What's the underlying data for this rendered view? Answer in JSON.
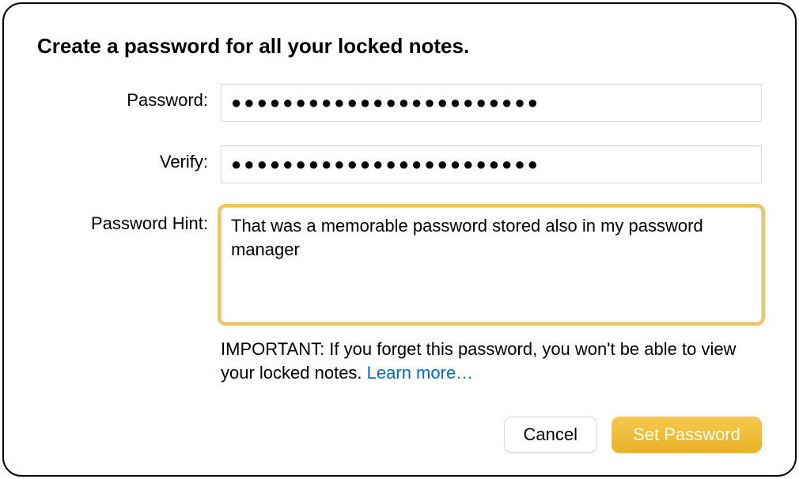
{
  "dialog": {
    "title": "Create a password for all your locked notes.",
    "fields": {
      "password": {
        "label": "Password:",
        "value": "●●●●●●●●●●●●●●●●●●●●●●●●"
      },
      "verify": {
        "label": "Verify:",
        "value": "●●●●●●●●●●●●●●●●●●●●●●●●"
      },
      "hint": {
        "label": "Password Hint:",
        "value": "That was a memorable password stored also in my password manager"
      }
    },
    "important": {
      "text": "IMPORTANT: If you forget this password, you won't be able to view your locked notes. ",
      "learn_more": "Learn more…"
    },
    "buttons": {
      "cancel": "Cancel",
      "set_password": "Set Password"
    }
  }
}
